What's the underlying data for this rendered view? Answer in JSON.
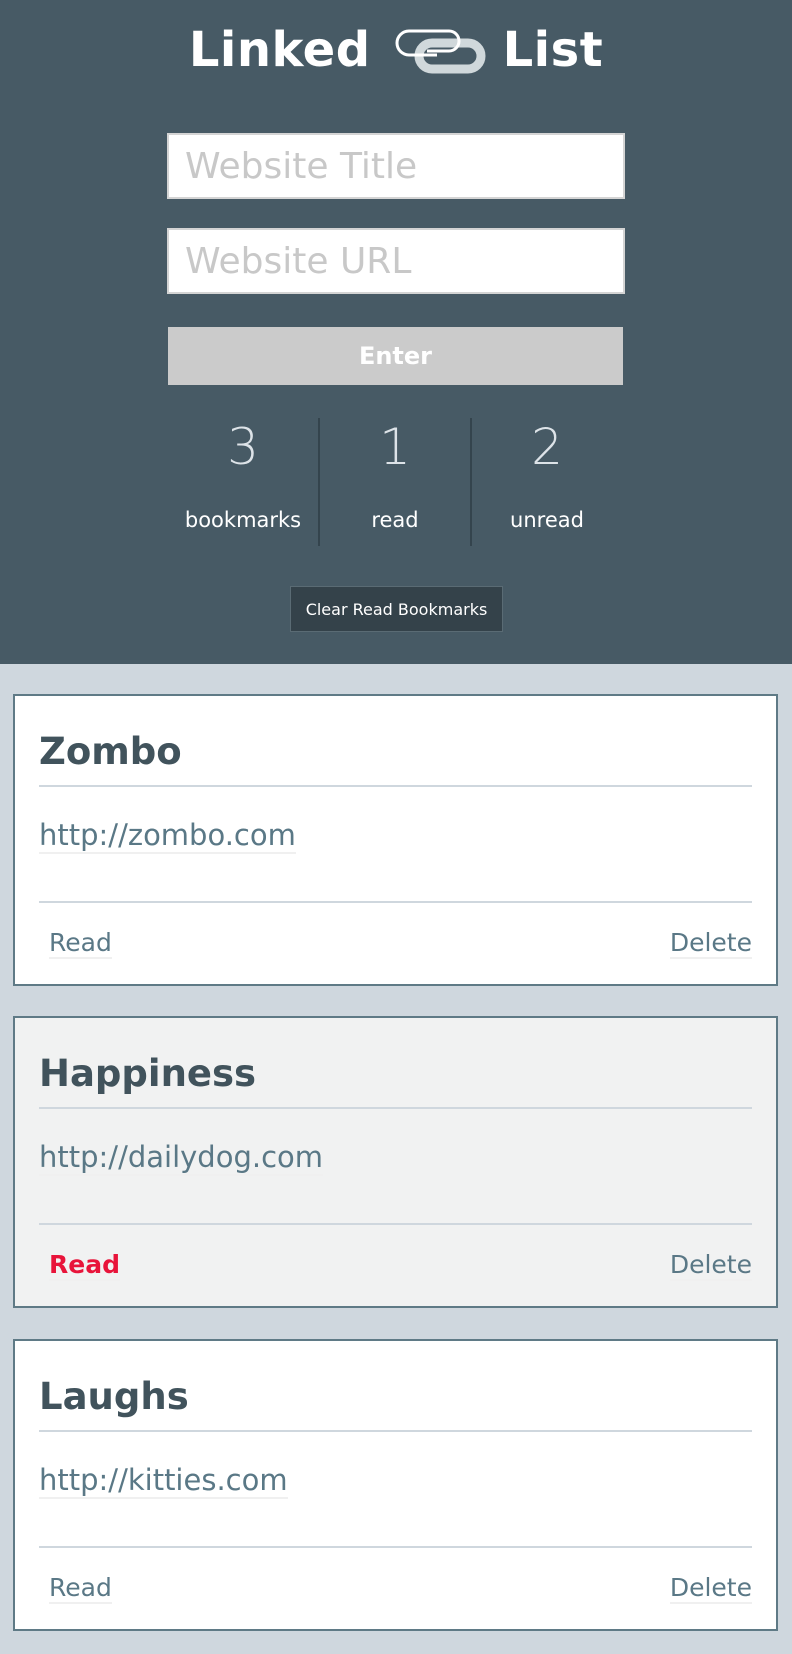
{
  "header": {
    "title_left": "Linked",
    "title_right": "List",
    "logo_icon": "paperclip-link-icon"
  },
  "form": {
    "title_placeholder": "Website Title",
    "url_placeholder": "Website URL",
    "enter_label": "Enter"
  },
  "counters": [
    {
      "value": "3",
      "label": "bookmarks"
    },
    {
      "value": "1",
      "label": "read"
    },
    {
      "value": "2",
      "label": "unread"
    }
  ],
  "clear_label": "Clear Read Bookmarks",
  "bookmarks": [
    {
      "title": "Zombo",
      "url": "http://zombo.com",
      "read_label": "Read",
      "delete_label": "Delete",
      "read": false
    },
    {
      "title": "Happiness",
      "url": "http://dailydog.com",
      "read_label": "Read",
      "delete_label": "Delete",
      "read": true
    },
    {
      "title": "Laughs",
      "url": "http://kitties.com",
      "read_label": "Read",
      "delete_label": "Delete",
      "read": false
    }
  ],
  "colors": {
    "header": "#475a65",
    "background": "#cfd7de",
    "read_active": "#e8143a"
  }
}
